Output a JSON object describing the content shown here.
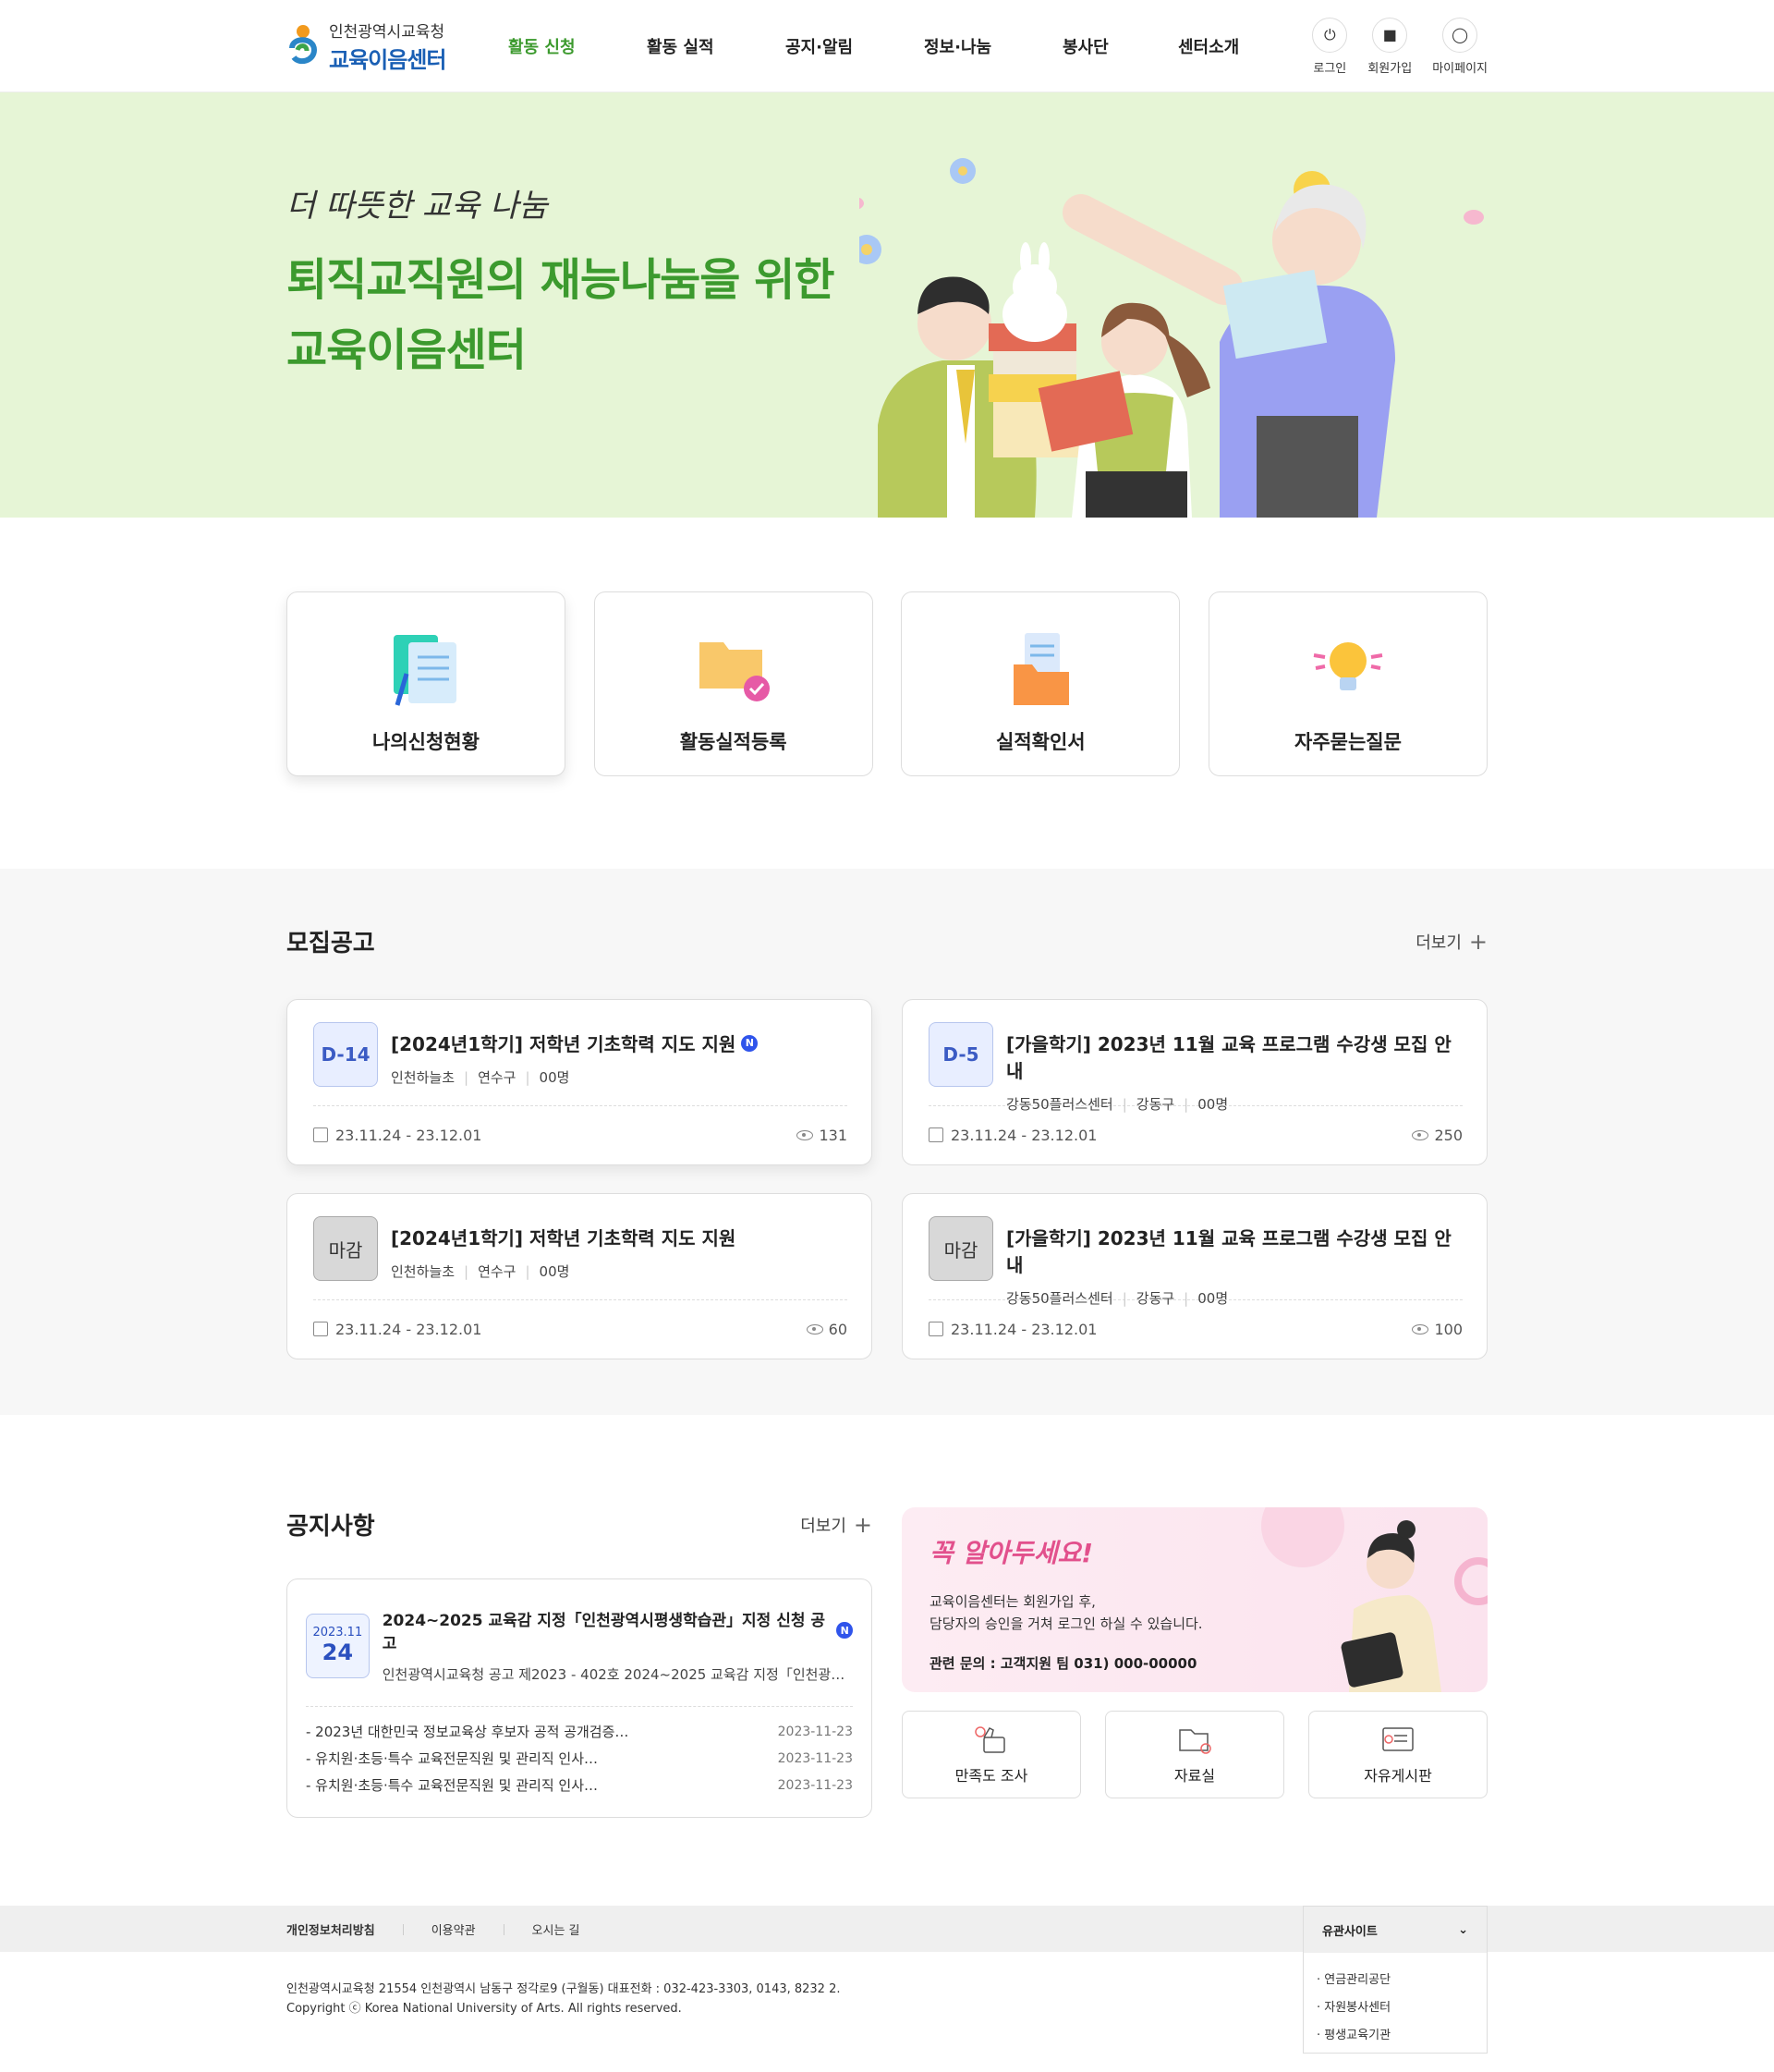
{
  "header": {
    "org": "인천광역시교육청",
    "site": "교육이음센터",
    "nav": [
      "활동 신청",
      "활동 실적",
      "공지·알림",
      "정보·나눔",
      "봉사단",
      "센터소개"
    ],
    "util": [
      "로그인",
      "회원가입",
      "마이페이지"
    ]
  },
  "hero": {
    "small": "더 따뜻한 교육 나눔",
    "line1": "퇴직교직원의 재능나눔을 위한",
    "line2": "교육이음센터"
  },
  "quick": [
    "나의신청현황",
    "활동실적등록",
    "실적확인서",
    "자주묻는질문"
  ],
  "recruit": {
    "title": "모집공고",
    "more": "더보기",
    "items": [
      {
        "badge": "D-14",
        "title": "[2024년1학기] 저학년 기초학력 지도 지원",
        "new": "N",
        "org": "인천하늘초",
        "area": "연수구",
        "count": "00명",
        "period": "23.11.24 - 23.12.01",
        "views": "131"
      },
      {
        "badge": "D-5",
        "title": "[가을학기] 2023년 11월 교육 프로그램 수강생 모집 안내",
        "new": "",
        "org": "강동50플러스센터",
        "area": "강동구",
        "count": "00명",
        "period": "23.11.24 - 23.12.01",
        "views": "250"
      },
      {
        "badge": "마감",
        "title": "[2024년1학기] 저학년 기초학력 지도 지원",
        "new": "",
        "org": "인천하늘초",
        "area": "연수구",
        "count": "00명",
        "period": "23.11.24 - 23.12.01",
        "views": "60"
      },
      {
        "badge": "마감",
        "title": "[가을학기] 2023년 11월 교육 프로그램 수강생 모집 안내",
        "new": "",
        "org": "강동50플러스센터",
        "area": "강동구",
        "count": "00명",
        "period": "23.11.24 - 23.12.01",
        "views": "100"
      }
    ]
  },
  "notice": {
    "title": "공지사항",
    "more": "더보기",
    "featured": {
      "ym": "2023.11",
      "day": "24",
      "title": "2024~2025 교육감 지정「인천광역시평생학습관」지정 신청 공고",
      "new": "N",
      "sub": "인천광역시교육청 공고 제2023 - 402호 2024~2025 교육감 지정「인천광…"
    },
    "list": [
      {
        "text": "- 2023년 대한민국 정보교육상 후보자 공적 공개검증…",
        "date": "2023-11-23"
      },
      {
        "text": "- 유치원·초등·특수 교육전문직원 및 관리직 인사…",
        "date": "2023-11-23"
      },
      {
        "text": "- 유치원·초등·특수 교육전문직원 및 관리직 인사…",
        "date": "2023-11-23"
      }
    ]
  },
  "banner": {
    "title": "꼭 알아두세요!",
    "desc1": "교육이음센터는 회원가입 후,",
    "desc2": "담당자의 승인을 거쳐 로그인 하실 수 있습니다.",
    "contact": "관련 문의 : 고객지원 팀 031) 000-00000"
  },
  "shortcuts": [
    "만족도 조사",
    "자료실",
    "자유게시판"
  ],
  "footer": {
    "links": [
      "개인정보처리방침",
      "이용약관",
      "오시는 길"
    ],
    "related_title": "유관사이트",
    "related": [
      "· 연금관리공단",
      "· 자원봉사센터",
      "· 평생교육기관"
    ],
    "address": "인천광역시교육청 21554 인천광역시 남동구 정각로9 (구월동) 대표전화 : 032-423-3303, 0143, 8232 2.",
    "copyright": "Copyright ⓒ Korea National University of Arts. All rights reserved."
  },
  "colors": {
    "accent": "#3c9a2e",
    "hero_bg": "#e6f5d6",
    "badge_blue": "#3b5bc4",
    "banner_pink": "#e2508c"
  }
}
